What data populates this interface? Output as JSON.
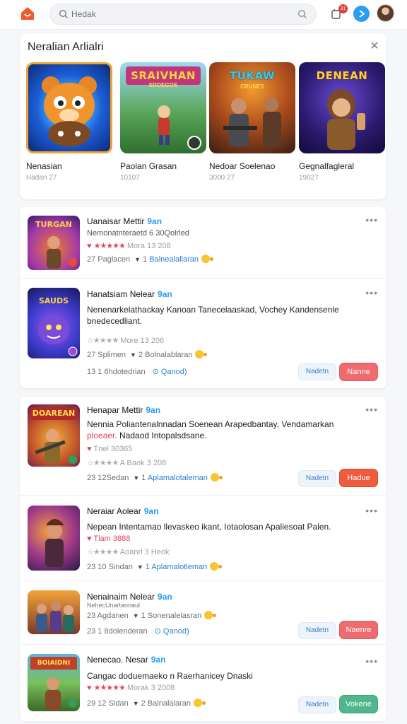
{
  "header": {
    "search_placeholder": "Hedak",
    "notification_count": "31"
  },
  "featured": {
    "title": "Neralian Arlialri",
    "games": [
      {
        "name": "Nenasian",
        "count": "Hadan 27",
        "banner": ""
      },
      {
        "name": "Paolan Grasan",
        "count": "10107",
        "banner": "SRAIVHAN",
        "banner_sub": "SROEGOS"
      },
      {
        "name": "Nedoar Soelenao",
        "count": "3000 27",
        "banner": "TUKAW",
        "banner_sub": "CRUNES"
      },
      {
        "name": "Gegnalfagleral",
        "count": "19027",
        "banner": "DENEAN",
        "banner_sub": ""
      }
    ]
  },
  "feed": [
    {
      "title": "Uanaisar Mettir",
      "accent": "9an",
      "thumb_banner": "TURGAN",
      "subtitle": "Nemonatnteraetd 6 30Qolrled",
      "rating_text": "Mora 13 208",
      "meta_left": "27 Paglacen",
      "meta_mid": "Balnealallaran"
    },
    {
      "title": "Hanatsiam Nelear",
      "accent": "9an",
      "thumb_banner": "SAUDS",
      "description": "Nenenarkelathackay Kanoan Tanecelaaskad, Vochey Kandensenle bnedecedliant.",
      "rating_text": "More 13 206",
      "meta_left": "27 Splimen",
      "meta_mid": "Bolnalablaran",
      "bottom_left": "13 1 6hdotedrian",
      "bottom_link": "Qanod",
      "btn_secondary": "Nadetn",
      "btn_primary": "Nanne"
    },
    {
      "title": "Henapar Mettir",
      "accent": "9an",
      "thumb_banner": "DOAREAN",
      "description_a": "Nennia Poliantenalnnadan Soenean Arapedbantay, Vendamarkan",
      "description_b_red": "ploeaer.",
      "description_b": "Nadaod Intopalsdsane.",
      "sub_rating": "Tnel 30365",
      "rating_text": "A Baok 3 208",
      "meta_left": "23 12Sedan",
      "meta_mid": "Aplamalotaleman",
      "btn_secondary": "Nadetn",
      "btn_primary": "Hadue"
    },
    {
      "title": "Neraiar Aolear",
      "accent": "9an",
      "thumb_banner": "",
      "description": "Nepean Intentamao llevaskeo ikant, Iotaolosan Apaliesoat Palen.",
      "sub_rating": "Tlam 3888",
      "rating_text": "Aoanrl 3 Heok",
      "meta_left": "23 10 Sindan",
      "meta_mid": "Aplamalotleman"
    },
    {
      "title": "Nenainaim Nelear",
      "accent": "9an",
      "thumb_banner": "",
      "subtitle": "NehecUnartannaul",
      "meta_left": "23 Agdanen",
      "meta_mid": "Sonenalelasran",
      "bottom_left": "23 1 8dolenderan",
      "bottom_link": "Qanod",
      "btn_secondary": "Nadetn",
      "btn_primary": "Naenre"
    },
    {
      "title": "Nenecao. Nesar",
      "accent": "9an",
      "thumb_banner": "BOIAIDNI",
      "description": "Cangac doduemaeko n Raerhanicey Dnaski",
      "rating_text": "Morak 3 2008",
      "meta_left": "29 12 Sidan",
      "meta_mid": "Balnalalaran",
      "btn_secondary": "Nadetn",
      "btn_primary": "Vokene"
    }
  ]
}
